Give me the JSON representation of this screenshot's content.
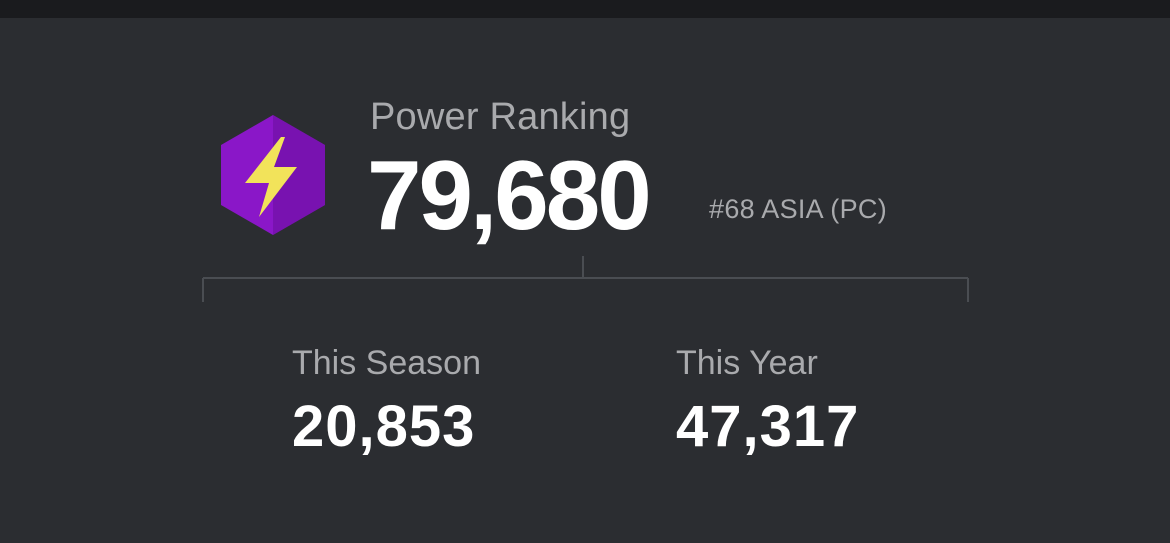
{
  "power_ranking": {
    "title": "Power Ranking",
    "value": "79,680",
    "rank": "#68 ASIA (PC)",
    "badge_icon": "lightning-bolt-icon",
    "badge_color": "#8a17c8",
    "bolt_color": "#f2e35a"
  },
  "stats": {
    "season": {
      "label": "This Season",
      "value": "20,853"
    },
    "year": {
      "label": "This Year",
      "value": "47,317"
    }
  }
}
